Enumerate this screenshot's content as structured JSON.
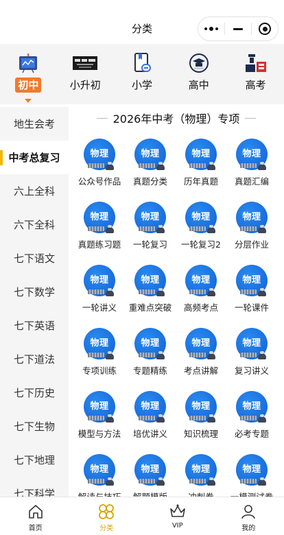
{
  "header": {
    "title": "分类"
  },
  "levels": [
    {
      "label": "初中",
      "icon": "chalkboard-icon",
      "active": true
    },
    {
      "label": "小升初",
      "icon": "xiaoshengchu-banner-icon",
      "active": false
    },
    {
      "label": "小学",
      "icon": "book-link-icon",
      "active": false
    },
    {
      "label": "高中",
      "icon": "graduation-cap-icon",
      "active": false
    },
    {
      "label": "高考",
      "icon": "gaokao-logo-icon",
      "active": false
    }
  ],
  "sidebar": {
    "items": [
      {
        "label": "地生会考"
      },
      {
        "label": "中考总复习"
      },
      {
        "label": "六上全科"
      },
      {
        "label": "六下全科"
      },
      {
        "label": "七下语文"
      },
      {
        "label": "七下数学"
      },
      {
        "label": "七下英语"
      },
      {
        "label": "七下道法"
      },
      {
        "label": "七下历史"
      },
      {
        "label": "七下生物"
      },
      {
        "label": "七下地理"
      },
      {
        "label": "七下科学"
      }
    ],
    "active_index": 1
  },
  "main": {
    "section_title": "2026年中考（物理）专项",
    "tile_icon_text": "物理",
    "tiles": [
      {
        "label": "公众号作品"
      },
      {
        "label": "真题分类"
      },
      {
        "label": "历年真题"
      },
      {
        "label": "真题汇编"
      },
      {
        "label": "真题练习题"
      },
      {
        "label": "一轮复习"
      },
      {
        "label": "一轮复习2"
      },
      {
        "label": "分层作业"
      },
      {
        "label": "一轮讲义"
      },
      {
        "label": "重难点突破"
      },
      {
        "label": "高频考点"
      },
      {
        "label": "一轮课件"
      },
      {
        "label": "专项训练"
      },
      {
        "label": "专题精练"
      },
      {
        "label": "考点讲解"
      },
      {
        "label": "复习讲义"
      },
      {
        "label": "模型与方法"
      },
      {
        "label": "培优讲义"
      },
      {
        "label": "知识梳理"
      },
      {
        "label": "必考专题"
      },
      {
        "label": "解读与技巧"
      },
      {
        "label": "解题模版"
      },
      {
        "label": "冲刺卷"
      },
      {
        "label": "一模测试卷"
      }
    ]
  },
  "bottom_nav": [
    {
      "label": "首页",
      "icon": "home-icon",
      "active": false
    },
    {
      "label": "分类",
      "icon": "category-icon",
      "active": true
    },
    {
      "label": "VIP",
      "icon": "crown-icon",
      "active": false
    },
    {
      "label": "我的",
      "icon": "user-icon",
      "active": false
    }
  ],
  "colors": {
    "accent": "#f07a2b",
    "sidebar_marker": "#f2b705",
    "tile_blue": "#1a73e8",
    "nav_active": "#d9a400"
  }
}
